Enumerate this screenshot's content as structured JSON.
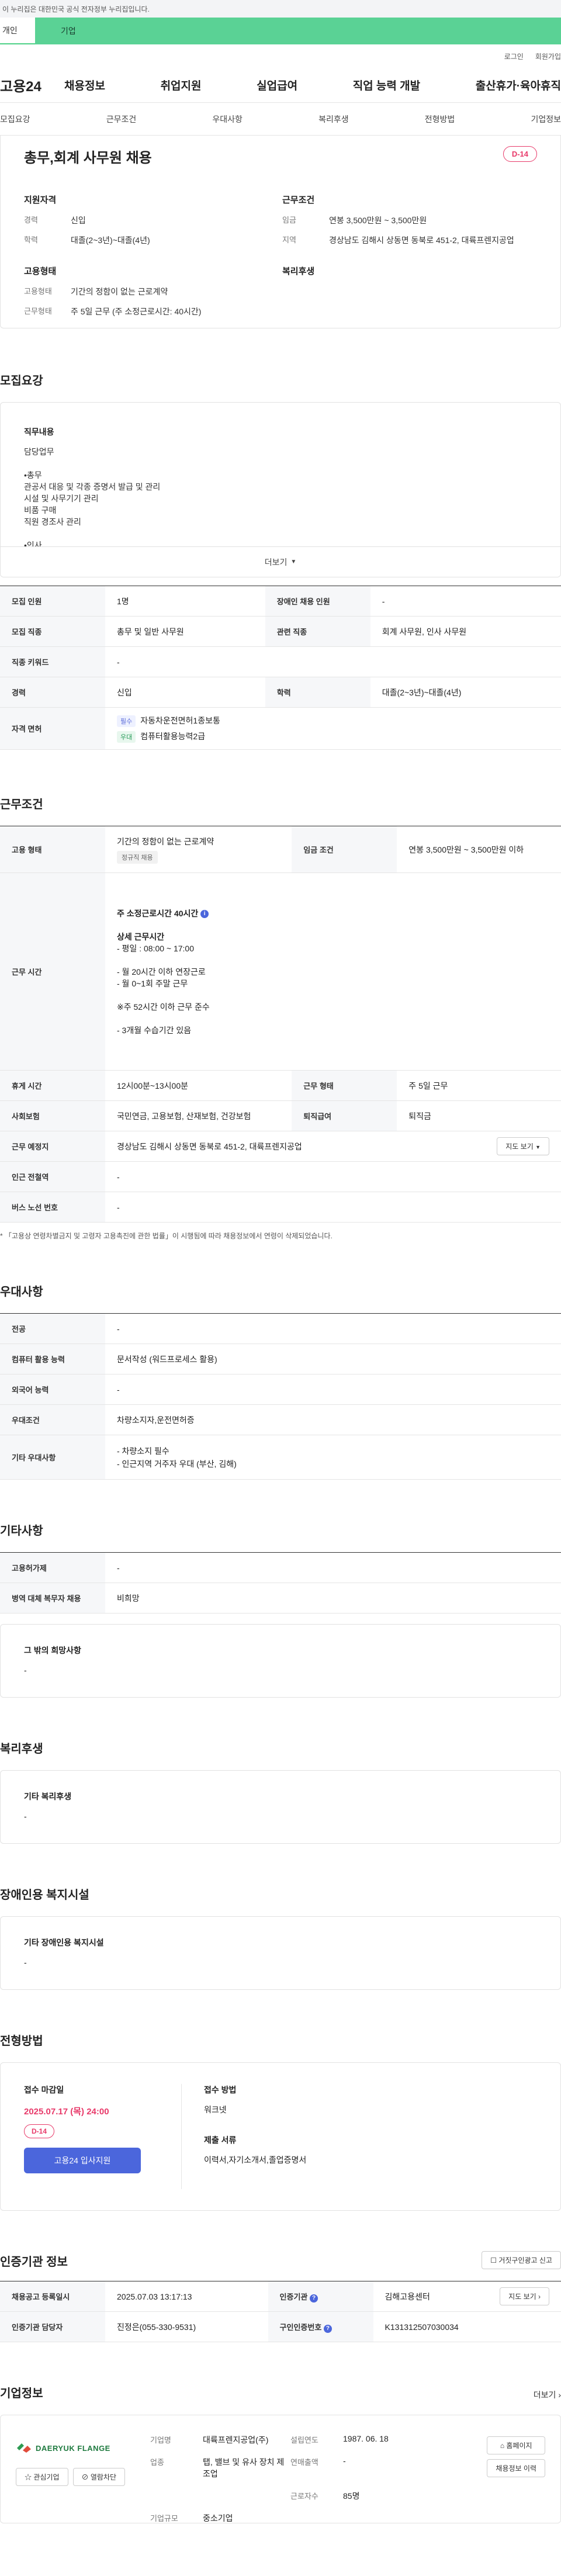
{
  "gov_bar": {
    "text": "이 누리집은 대한민국 공식 전자정부 누리집입니다."
  },
  "tabs": {
    "tab_individual": "개인",
    "tab_company": "기업"
  },
  "util": {
    "login": "로그인",
    "signup": "회원가입"
  },
  "header": {
    "logo": "고용24",
    "nav": [
      "채용정보",
      "취업지원",
      "실업급여",
      "직업 능력 개발",
      "출산휴가·육아휴직"
    ]
  },
  "anchors": [
    "모집요강",
    "근무조건",
    "우대사항",
    "복리후생",
    "전형방법",
    "기업정보"
  ],
  "job": {
    "title": "총무,회계 사무원 채용",
    "dday": "D-14",
    "qual_heading": "지원자격",
    "cond_heading": "근무조건",
    "emp_heading": "고용형태",
    "welfare_heading": "복리후생",
    "qual": [
      {
        "k": "경력",
        "v": "신입"
      },
      {
        "k": "학력",
        "v": "대졸(2~3년)~대졸(4년)"
      }
    ],
    "cond": [
      {
        "k": "임금",
        "v": "연봉 3,500만원 ~ 3,500만원"
      },
      {
        "k": "지역",
        "v": "경상남도 김해시 상동면 동북로 451-2, 대륙프렌지공업"
      }
    ],
    "emp": [
      {
        "k": "고용형태",
        "v": "기간의 정함이 없는 근로계약"
      },
      {
        "k": "근무형태",
        "v": "주 5일 근무 (주 소정근로시간: 40시간)"
      }
    ]
  },
  "recruit": {
    "heading": "모집요강",
    "desc_title": "직무내용",
    "desc_lines": [
      "담당업무",
      "",
      "•총무",
      "관공서 대응 및 각종 증명서 발급 및 관리",
      "시설 및 사무기기 관리",
      "비품 구매",
      "직원 경조사 관리",
      "",
      "•인사"
    ],
    "more": "더보기",
    "rows": [
      {
        "k": "모집 인원",
        "v": "1명",
        "k2": "장애인 채용 인원",
        "v2": "-"
      },
      {
        "k": "모집 직종",
        "v": "총무 및 일반 사무원",
        "k2": "관련 직종",
        "v2": "회계 사무원, 인사 사무원"
      },
      {
        "k": "직종 키워드",
        "v": "-"
      },
      {
        "k": "경력",
        "v": "신입",
        "k2": "학력",
        "v2": "대졸(2~3년)~대졸(4년)"
      }
    ],
    "license_label": "자격 면허",
    "licenses": [
      {
        "chip": "필수",
        "name": "자동차운전면허1종보통"
      },
      {
        "chip": "우대",
        "name": "컴퓨터활용능력2급"
      }
    ]
  },
  "work": {
    "heading": "근무조건",
    "emp_type_label": "고용 형태",
    "emp_type": "기간의 정함이 없는 근로계약",
    "emp_type_chip": "정규직 채용",
    "wage_label": "임금 조건",
    "wage": "연봉 3,500만원 ~ 3,500만원 이하",
    "hours_label": "근무 시간",
    "hours_lines": [
      "주 소정근로시간 40시간",
      "",
      "상세 근무시간",
      "- 평일 : 08:00 ~ 17:00",
      "",
      "- 월 20시간 이하 연장근로",
      "- 월 0~1회 주말 근무",
      "",
      "※주 52시간 이하 근무 준수",
      "",
      "- 3개월 수습기간 있음"
    ],
    "break_label": "휴게 시간",
    "break": "12시00분~13시00분",
    "form_label": "근무 형태",
    "form": "주 5일 근무",
    "insurance_label": "사회보험",
    "insurance": "국민연금, 고용보험, 산재보험, 건강보험",
    "retire_label": "퇴직급여",
    "retire": "퇴직금",
    "place_label": "근무 예정지",
    "place": "경상남도 김해시 상동면 동북로 451-2, 대륙프렌지공업",
    "map_btn": "지도 보기",
    "subway_label": "인근 전철역",
    "subway": "-",
    "bus_label": "버스 노선 번호",
    "bus": "-",
    "note": "* 「고용상 연령차별금지 및 고령자 고용촉진에 관한 법률」이 시행됨에 따라 채용정보에서 연령이 삭제되었습니다."
  },
  "pref": {
    "heading": "우대사항",
    "rows": [
      {
        "k": "전공",
        "v": "-"
      },
      {
        "k": "컴퓨터 활용 능력",
        "v": "문서작성 (워드프로세스 활용)"
      },
      {
        "k": "외국어 능력",
        "v": "-"
      },
      {
        "k": "우대조건",
        "v": "차량소지자,운전면허증"
      }
    ],
    "other_label": "기타 우대사항",
    "other": [
      "- 차량소지 필수",
      "- 인근지역 거주자 우대 (부산, 김해)"
    ]
  },
  "etc": {
    "heading": "기타사항",
    "rows": [
      {
        "k": "고용허가제",
        "v": "-"
      },
      {
        "k": "병역 대체 복무자 채용",
        "v": "비희망"
      }
    ],
    "wish_title": "그 밖의 희망사항",
    "wish": "-"
  },
  "welfare": {
    "heading": "복리후생",
    "title": "기타 복리후생",
    "value": "-"
  },
  "disabled": {
    "heading": "장애인용 복지시설",
    "title": "기타 장애인용 복지시설",
    "value": "-"
  },
  "apply": {
    "heading": "전형방법",
    "deadline_label": "접수 마감일",
    "deadline": "2025.07.17 (목) 24:00",
    "dday": "D-14",
    "apply_btn": "고용24 입사지원",
    "method_label": "접수 방법",
    "method": "워크넷",
    "docs_label": "제출 서류",
    "docs": "이력서,자기소개서,졸업증명서"
  },
  "agency": {
    "heading": "인증기관 정보",
    "report_btn": "거짓구인광고 신고",
    "reg_label": "채용공고 등록일시",
    "reg": "2025.07.03 13:17:13",
    "org_label": "인증기관",
    "org": "김해고용센터",
    "map_btn": "지도 보기",
    "manager_label": "인증기관 담당자",
    "manager": "진정은(055-330-9531)",
    "no_label": "구인인증번호",
    "no": "K131312507030034"
  },
  "company": {
    "heading": "기업정보",
    "more": "더보기",
    "logo_text": "DAERYUK FLANGE",
    "interest_btn": "관심기업",
    "block_btn": "열람차단",
    "fields": [
      {
        "k": "기업명",
        "v": "대륙프렌지공업(주)"
      },
      {
        "k": "설립연도",
        "v": "1987. 06. 18"
      },
      {
        "k": "업종",
        "v": "탭, 밸브 및 유사 장치 제조업"
      },
      {
        "k": "연매출액",
        "v": "-"
      },
      {
        "k": "",
        "v": ""
      },
      {
        "k": "근로자수",
        "v": "85명"
      },
      {
        "k": "기업규모",
        "v": "중소기업"
      }
    ],
    "home_btn": "홈페이지",
    "jobs_btn": "채용정보 이력"
  },
  "colors": {
    "accent": "#4b66dc",
    "dday": "#e83a6a",
    "brand_green": "#5ad295"
  }
}
